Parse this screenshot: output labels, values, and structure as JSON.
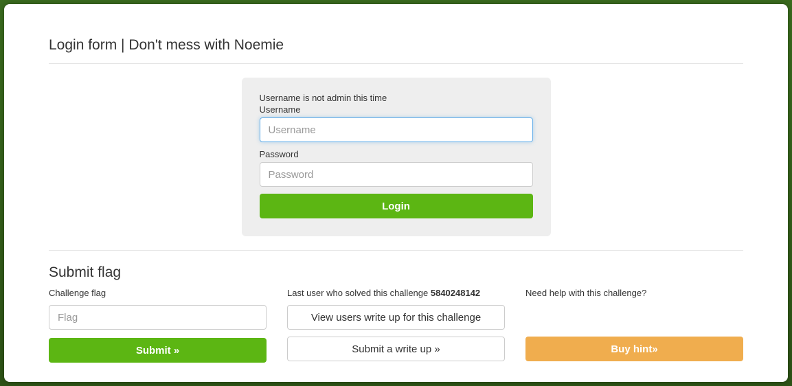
{
  "header": {
    "title": "Login form | Don't mess with Noemie"
  },
  "login": {
    "hint": "Username is not admin this time",
    "username_label": "Username",
    "username_placeholder": "Username",
    "username_value": "",
    "password_label": "Password",
    "password_placeholder": "Password",
    "password_value": "",
    "button_label": "Login"
  },
  "submit_section": {
    "title": "Submit flag"
  },
  "col1": {
    "label": "Challenge flag",
    "flag_placeholder": "Flag",
    "flag_value": "",
    "submit_label": "Submit »"
  },
  "col2": {
    "label_prefix": "Last user who solved this challenge ",
    "solver_id": "5840248142",
    "view_writeups_label": "View users write up for this challenge",
    "submit_writeup_label": "Submit a write up »"
  },
  "col3": {
    "label": "Need help with this challenge?",
    "buy_hint_label": "Buy hint»"
  }
}
